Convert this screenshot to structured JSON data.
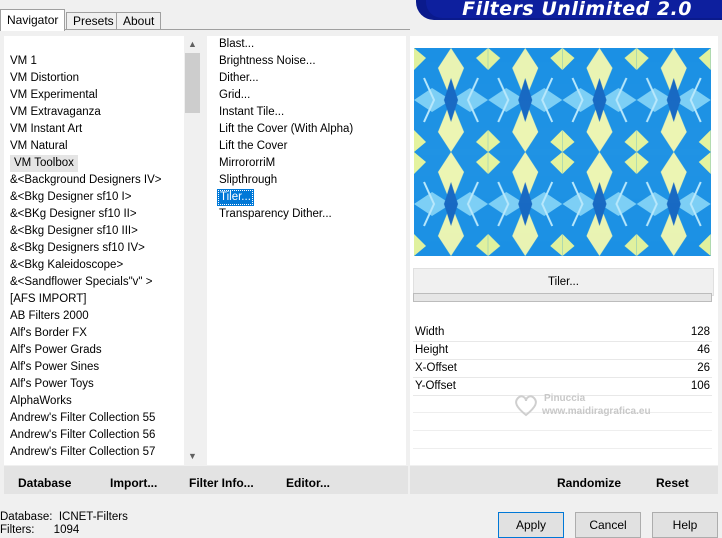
{
  "tabs": [
    "Navigator",
    "Presets",
    "About"
  ],
  "banner_title": "Filters Unlimited 2.0",
  "categories": [
    "VM 1",
    "VM Distortion",
    "VM Experimental",
    "VM Extravaganza",
    "VM Instant Art",
    "VM Natural",
    "VM Toolbox",
    "&<Background Designers IV>",
    "&<Bkg Designer sf10 I>",
    "&<BKg Designer sf10 II>",
    "&<Bkg Designer sf10 III>",
    "&<Bkg Designers sf10 IV>",
    "&<Bkg Kaleidoscope>",
    "&<Sandflower Specials\"v\" >",
    "[AFS IMPORT]",
    "AB Filters 2000",
    "Alf's Border FX",
    "Alf's Power Grads",
    "Alf's Power Sines",
    "Alf's Power Toys",
    "AlphaWorks",
    "Andrew's Filter Collection 55",
    "Andrew's Filter Collection 56",
    "Andrew's Filter Collection 57"
  ],
  "selected_category": "VM Toolbox",
  "filters": [
    "Blast...",
    "Brightness Noise...",
    "Dither...",
    "Grid...",
    "Instant Tile...",
    "Lift the Cover (With Alpha)",
    "Lift the Cover",
    "MirrororriM",
    "Slipthrough",
    "Tiler...",
    "Transparency Dither..."
  ],
  "selected_filter": "Tiler...",
  "current_filter_name": "Tiler...",
  "params": [
    {
      "label": "Width",
      "value": "128"
    },
    {
      "label": "Height",
      "value": "46"
    },
    {
      "label": "X-Offset",
      "value": "26"
    },
    {
      "label": "Y-Offset",
      "value": "106"
    }
  ],
  "watermark": {
    "line1": "Pinuccia",
    "line2": "www.maidiragrafica.eu"
  },
  "toolbar_left": {
    "database": "Database",
    "import": "Import...",
    "filter_info": "Filter Info...",
    "editor": "Editor..."
  },
  "toolbar_right": {
    "randomize": "Randomize",
    "reset": "Reset"
  },
  "status": {
    "database_label": "Database:",
    "database_value": "ICNET-Filters",
    "filters_label": "Filters:",
    "filters_value": "1094"
  },
  "dialog_buttons": {
    "apply": "Apply",
    "cancel": "Cancel",
    "help": "Help"
  },
  "colors": {
    "selection": "#0078d7",
    "banner": "#0d1f9e",
    "preview_blue": "#1e88e5",
    "preview_yellow": "#f4f6a8"
  }
}
